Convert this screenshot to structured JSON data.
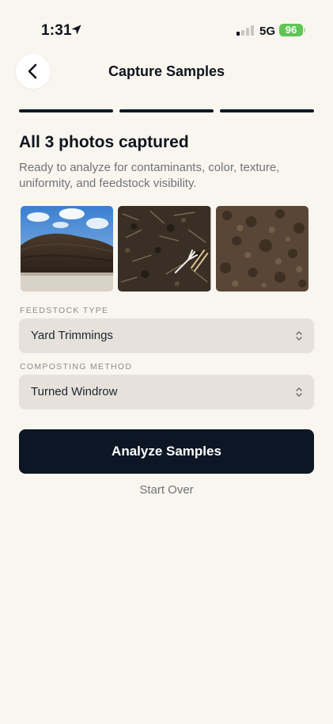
{
  "status_bar": {
    "time": "1:31",
    "network": "5G",
    "battery": "96",
    "signal_bars_active": 1,
    "signal_bars_total": 4,
    "battery_color": "#61c454"
  },
  "header": {
    "title": "Capture Samples",
    "back_icon": "chevron-left-icon"
  },
  "progress": {
    "steps_total": 3,
    "steps_completed": 3,
    "color": "#0f1824"
  },
  "summary": {
    "headline": "All 3 photos captured",
    "description": "Ready to analyze for contaminants, color, texture, uniformity, and feedstock visibility."
  },
  "photos": [
    {
      "name": "compost-pile-photo"
    },
    {
      "name": "compost-closeup-with-fork-photo"
    },
    {
      "name": "compost-texture-photo"
    }
  ],
  "feedstock": {
    "label": "FEEDSTOCK TYPE",
    "value": "Yard Trimmings"
  },
  "method": {
    "label": "COMPOSTING METHOD",
    "value": "Turned Windrow"
  },
  "actions": {
    "analyze_label": "Analyze Samples",
    "start_over_label": "Start Over",
    "accent": "#0d1624"
  }
}
